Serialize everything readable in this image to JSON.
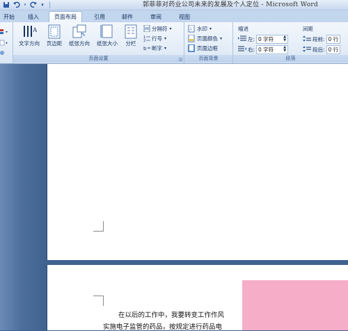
{
  "titlebar": {
    "title": "郭菲菲对药业公司未来的发展及个人定位 - Microsoft Word",
    "qat": [
      "save-icon",
      "undo-icon",
      "redo-icon",
      "customize-icon"
    ]
  },
  "tabs": [
    {
      "label": "开始",
      "active": false
    },
    {
      "label": "插入",
      "active": false
    },
    {
      "label": "页面布局",
      "active": true
    },
    {
      "label": "引用",
      "active": false
    },
    {
      "label": "邮件",
      "active": false
    },
    {
      "label": "审阅",
      "active": false
    },
    {
      "label": "视图",
      "active": false
    }
  ],
  "ribbon": {
    "page_setup": {
      "label": "页面设置",
      "text_direction": "文字方向",
      "margins": "页边距",
      "orientation": "纸张方向",
      "size": "纸张大小",
      "columns": "分栏",
      "breaks": "分隔符",
      "line_numbers": "行号",
      "hyphenation": "断字"
    },
    "page_background": {
      "label": "页面背景",
      "watermark": "水印",
      "page_color": "页面颜色",
      "page_borders": "页面边框"
    },
    "paragraph": {
      "label": "段落",
      "indent_label": "缩进",
      "indent_left_label": "左:",
      "indent_left_value": "0 字符",
      "indent_right_label": "右:",
      "indent_right_value": "0 字符",
      "spacing_label": "间距",
      "spacing_before_label": "段前:",
      "spacing_before_value": "0 行",
      "spacing_after_label": "段后:",
      "spacing_after_value": "0 行"
    }
  },
  "document": {
    "line1": "在以后的工作中，我要转变工作作风",
    "line2": "实施电子监管的药品，按规定进行药品电"
  }
}
